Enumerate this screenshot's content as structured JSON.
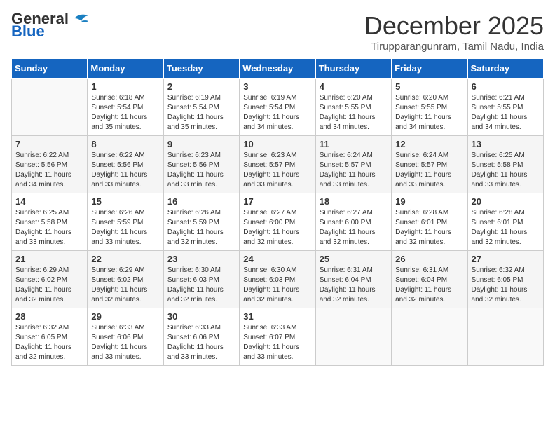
{
  "header": {
    "logo": {
      "line1": "General",
      "line2": "Blue"
    },
    "title": "December 2025",
    "location": "Tirupparangunram, Tamil Nadu, India"
  },
  "days_of_week": [
    "Sunday",
    "Monday",
    "Tuesday",
    "Wednesday",
    "Thursday",
    "Friday",
    "Saturday"
  ],
  "weeks": [
    [
      {
        "day": "",
        "info": ""
      },
      {
        "day": "1",
        "info": "Sunrise: 6:18 AM\nSunset: 5:54 PM\nDaylight: 11 hours\nand 35 minutes."
      },
      {
        "day": "2",
        "info": "Sunrise: 6:19 AM\nSunset: 5:54 PM\nDaylight: 11 hours\nand 35 minutes."
      },
      {
        "day": "3",
        "info": "Sunrise: 6:19 AM\nSunset: 5:54 PM\nDaylight: 11 hours\nand 34 minutes."
      },
      {
        "day": "4",
        "info": "Sunrise: 6:20 AM\nSunset: 5:55 PM\nDaylight: 11 hours\nand 34 minutes."
      },
      {
        "day": "5",
        "info": "Sunrise: 6:20 AM\nSunset: 5:55 PM\nDaylight: 11 hours\nand 34 minutes."
      },
      {
        "day": "6",
        "info": "Sunrise: 6:21 AM\nSunset: 5:55 PM\nDaylight: 11 hours\nand 34 minutes."
      }
    ],
    [
      {
        "day": "7",
        "info": "Sunrise: 6:22 AM\nSunset: 5:56 PM\nDaylight: 11 hours\nand 34 minutes."
      },
      {
        "day": "8",
        "info": "Sunrise: 6:22 AM\nSunset: 5:56 PM\nDaylight: 11 hours\nand 33 minutes."
      },
      {
        "day": "9",
        "info": "Sunrise: 6:23 AM\nSunset: 5:56 PM\nDaylight: 11 hours\nand 33 minutes."
      },
      {
        "day": "10",
        "info": "Sunrise: 6:23 AM\nSunset: 5:57 PM\nDaylight: 11 hours\nand 33 minutes."
      },
      {
        "day": "11",
        "info": "Sunrise: 6:24 AM\nSunset: 5:57 PM\nDaylight: 11 hours\nand 33 minutes."
      },
      {
        "day": "12",
        "info": "Sunrise: 6:24 AM\nSunset: 5:57 PM\nDaylight: 11 hours\nand 33 minutes."
      },
      {
        "day": "13",
        "info": "Sunrise: 6:25 AM\nSunset: 5:58 PM\nDaylight: 11 hours\nand 33 minutes."
      }
    ],
    [
      {
        "day": "14",
        "info": "Sunrise: 6:25 AM\nSunset: 5:58 PM\nDaylight: 11 hours\nand 33 minutes."
      },
      {
        "day": "15",
        "info": "Sunrise: 6:26 AM\nSunset: 5:59 PM\nDaylight: 11 hours\nand 33 minutes."
      },
      {
        "day": "16",
        "info": "Sunrise: 6:26 AM\nSunset: 5:59 PM\nDaylight: 11 hours\nand 32 minutes."
      },
      {
        "day": "17",
        "info": "Sunrise: 6:27 AM\nSunset: 6:00 PM\nDaylight: 11 hours\nand 32 minutes."
      },
      {
        "day": "18",
        "info": "Sunrise: 6:27 AM\nSunset: 6:00 PM\nDaylight: 11 hours\nand 32 minutes."
      },
      {
        "day": "19",
        "info": "Sunrise: 6:28 AM\nSunset: 6:01 PM\nDaylight: 11 hours\nand 32 minutes."
      },
      {
        "day": "20",
        "info": "Sunrise: 6:28 AM\nSunset: 6:01 PM\nDaylight: 11 hours\nand 32 minutes."
      }
    ],
    [
      {
        "day": "21",
        "info": "Sunrise: 6:29 AM\nSunset: 6:02 PM\nDaylight: 11 hours\nand 32 minutes."
      },
      {
        "day": "22",
        "info": "Sunrise: 6:29 AM\nSunset: 6:02 PM\nDaylight: 11 hours\nand 32 minutes."
      },
      {
        "day": "23",
        "info": "Sunrise: 6:30 AM\nSunset: 6:03 PM\nDaylight: 11 hours\nand 32 minutes."
      },
      {
        "day": "24",
        "info": "Sunrise: 6:30 AM\nSunset: 6:03 PM\nDaylight: 11 hours\nand 32 minutes."
      },
      {
        "day": "25",
        "info": "Sunrise: 6:31 AM\nSunset: 6:04 PM\nDaylight: 11 hours\nand 32 minutes."
      },
      {
        "day": "26",
        "info": "Sunrise: 6:31 AM\nSunset: 6:04 PM\nDaylight: 11 hours\nand 32 minutes."
      },
      {
        "day": "27",
        "info": "Sunrise: 6:32 AM\nSunset: 6:05 PM\nDaylight: 11 hours\nand 32 minutes."
      }
    ],
    [
      {
        "day": "28",
        "info": "Sunrise: 6:32 AM\nSunset: 6:05 PM\nDaylight: 11 hours\nand 32 minutes."
      },
      {
        "day": "29",
        "info": "Sunrise: 6:33 AM\nSunset: 6:06 PM\nDaylight: 11 hours\nand 33 minutes."
      },
      {
        "day": "30",
        "info": "Sunrise: 6:33 AM\nSunset: 6:06 PM\nDaylight: 11 hours\nand 33 minutes."
      },
      {
        "day": "31",
        "info": "Sunrise: 6:33 AM\nSunset: 6:07 PM\nDaylight: 11 hours\nand 33 minutes."
      },
      {
        "day": "",
        "info": ""
      },
      {
        "day": "",
        "info": ""
      },
      {
        "day": "",
        "info": ""
      }
    ]
  ]
}
